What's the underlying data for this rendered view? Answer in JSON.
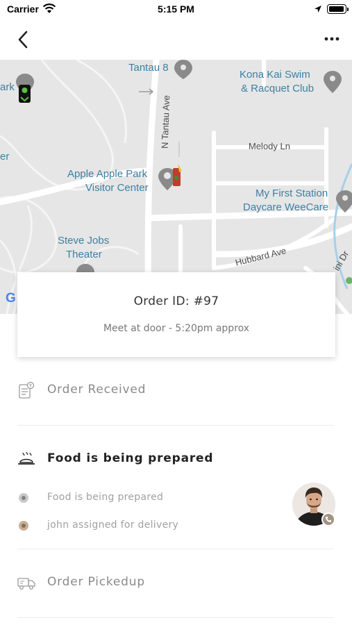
{
  "status_bar": {
    "carrier": "Carrier",
    "time": "5:15 PM"
  },
  "nav": {
    "back_icon": "chevron-left-icon",
    "more_icon": "ellipsis-icon"
  },
  "map": {
    "places": {
      "tantau": "Tantau 8",
      "kona_line1": "Kona Kai Swim",
      "kona_line2": "& Racquet Club",
      "apple_line1": "Apple Apple Park",
      "apple_line2": "Visitor Center",
      "daycare_line1": "My First Station",
      "daycare_line2": "Daycare WeeCare",
      "steve_line1": "Steve Jobs",
      "steve_line2": "Theater",
      "park_edge": "ark",
      "er_edge": "er"
    },
    "streets": {
      "n_tantau": "N Tantau Ave",
      "melody": "Melody Ln",
      "hubbard": "Hubbard Ave",
      "ini_dr": "ini Dr"
    },
    "google_mark": "G"
  },
  "order": {
    "id_text": "Order ID: #97",
    "eta_text": "Meet at door - 5:20pm approx"
  },
  "timeline": {
    "received": {
      "label": "Order Received",
      "icon": "receipt-icon"
    },
    "preparing": {
      "label": "Food is being prepared",
      "icon": "cloche-icon",
      "sub_items": [
        {
          "label": "Food is being prepared",
          "color": "#c9c9c9"
        },
        {
          "label": "john assigned for delivery",
          "color": "#c8ad94"
        }
      ]
    },
    "pickedup": {
      "label": "Order Pickedup",
      "icon": "delivery-truck-icon"
    }
  },
  "courier": {
    "avatar_icon": "avatar",
    "call_icon": "phone-icon"
  },
  "colors": {
    "accent": "#a39381",
    "map_bg": "#e6e6e6",
    "map_road": "#ffffff",
    "map_label": "#3d7fa3"
  }
}
